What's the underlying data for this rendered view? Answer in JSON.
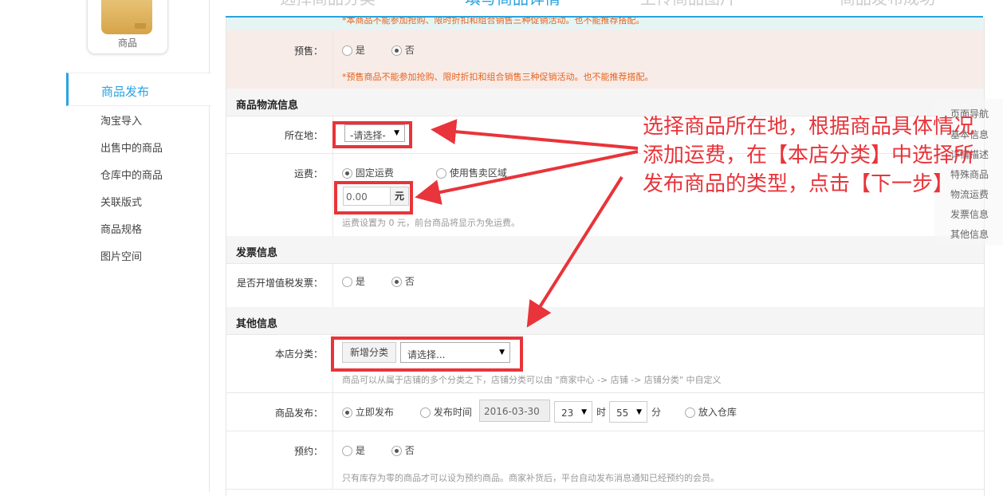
{
  "sidebar": {
    "icon_label": "商品",
    "active_item": "商品发布",
    "items": [
      "淘宝导入",
      "出售中的商品",
      "仓库中的商品",
      "关联版式",
      "商品规格",
      "图片空间"
    ]
  },
  "steps": [
    "选择商品分类",
    "填写商品详情",
    "上传商品图片",
    "商品发布成功"
  ],
  "form": {
    "top_notice": "*本商品不能参加抢购、限时折扣和组合销售三种促销活动。也不能推荐搭配。",
    "presale": {
      "label": "预售：",
      "yes": "是",
      "no": "否",
      "warning": "*预售商品不能参加抢购、限时折扣和组合销售三种促销活动。也不能推荐搭配。"
    },
    "logistics": {
      "section": "商品物流信息",
      "location_label": "所在地：",
      "location_placeholder": "-请选择-",
      "freight_label": "运费：",
      "freight_fixed": "固定运费",
      "freight_area": "使用售卖区域",
      "freight_value": "0.00",
      "freight_unit": "元",
      "freight_hint": "运费设置为 0 元，前台商品将显示为免运费。"
    },
    "invoice": {
      "section": "发票信息",
      "vat_label": "是否开增值税发票：",
      "yes": "是",
      "no": "否"
    },
    "other": {
      "section": "其他信息",
      "category_label": "本店分类：",
      "add_category": "新增分类",
      "category_placeholder": "请选择...",
      "category_hint": "商品可以从属于店铺的多个分类之下，店铺分类可以由 \"商家中心 -> 店铺 -> 店铺分类\" 中自定义",
      "publish_label": "商品发布：",
      "publish_now": "立即发布",
      "publish_time": "发布时间",
      "publish_date": "2016-03-30",
      "hour": "23",
      "hour_unit": "时",
      "minute": "55",
      "minute_unit": "分",
      "to_storage": "放入仓库",
      "reserve_label": "预约：",
      "yes": "是",
      "no": "否",
      "reserve_hint": "只有库存为零的商品才可以设为预约商品。商家补货后，平台自动发布消息通知已经预约的会员。"
    }
  },
  "annotation": "选择商品所在地，根据商品具体情况添加运费，在【本店分类】中选择所发布商品的类型，点击【下一步】",
  "right_nav": [
    "页面导航",
    "基本信息",
    "详情描述",
    "特殊商品",
    "物流运费",
    "发票信息",
    "其他信息"
  ],
  "colors": {
    "accent": "#29a3e0",
    "annotation_red": "#e8343a",
    "warning": "#e5631d"
  }
}
